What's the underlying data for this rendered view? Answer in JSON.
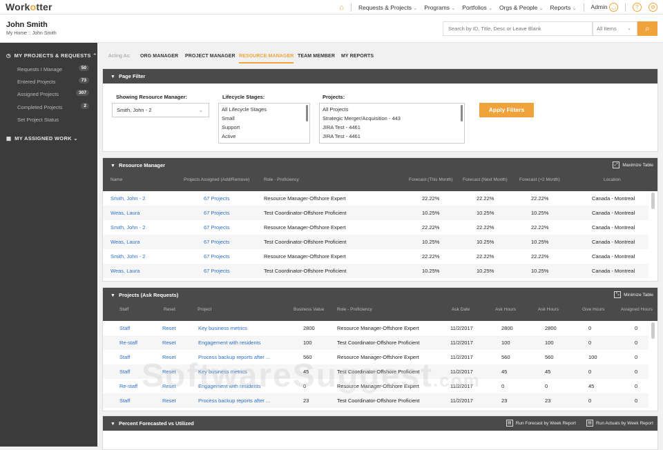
{
  "app": {
    "logo_prefix": "Work",
    "logo_o": "o",
    "logo_suffix": "tter"
  },
  "nav": {
    "items": [
      "Requests & Projects",
      "Programs",
      "Portfolios",
      "Orgs & People",
      "Reports"
    ],
    "user": "Admin",
    "help": "?"
  },
  "header": {
    "user_name": "John Smith",
    "breadcrumb": "My Home :: John Smith",
    "search_placeholder": "Search by ID, Title, Desc or Leave Blank",
    "scope": "All Items"
  },
  "sidebar": {
    "section1": "MY PROJECTS & REQUESTS",
    "items": [
      {
        "label": "Requests I Manage",
        "count": "50"
      },
      {
        "label": "Entered Projects",
        "count": "73"
      },
      {
        "label": "Assigned Projects",
        "count": "307"
      },
      {
        "label": "Completed Projects",
        "count": "2"
      },
      {
        "label": "Set Project Status",
        "count": ""
      }
    ],
    "section2": "MY ASSIGNED WORK"
  },
  "tabs": {
    "acting_as": "Acting As:",
    "items": [
      "ORG MANAGER",
      "PROJECT MANAGER",
      "RESOURCE MANAGER",
      "TEAM MEMBER",
      "MY REPORTS"
    ],
    "active": "RESOURCE MANAGER"
  },
  "filter": {
    "title": "Page Filter",
    "rm_label": "Showing Resource Manager:",
    "rm_value": "Smith, John - 2",
    "lc_label": "Lifecycle Stages:",
    "lc_options": [
      "All Lifecycle Stages",
      "Small",
      "Support",
      "Active"
    ],
    "proj_label": "Projects:",
    "proj_options": [
      "All Projects",
      "Strategic Merger/Acquisition - 443",
      "JIRA Test - 4461",
      "JIRA Test - 4461"
    ],
    "apply": "Apply Filters"
  },
  "rm_table": {
    "title": "Resource Manager",
    "action": "Maximize Table",
    "headers": [
      "Name",
      "Projects Assigned (Add/Remove)",
      "Role - Proficiency",
      "Forecast (This Month)",
      "Forecast (Next Month)",
      "Forecast (+2 Month)",
      "Location"
    ],
    "rows": [
      [
        "Smith, John - 2",
        "67 Projects",
        "Resource Manager-Offshore Expert",
        "22.22%",
        "22.22%",
        "22.22%",
        "Canada - Montreal"
      ],
      [
        "Weas, Laura",
        "67 Projects",
        "Test Coordinator-Offshore Proficient",
        "10.25%",
        "10.25%",
        "10.25%",
        "Canada - Montreal"
      ],
      [
        "Smith, John - 2",
        "67 Projects",
        "Resource Manager-Offshore Expert",
        "22.22%",
        "22.22%",
        "22.22%",
        "Canada - Montreal"
      ],
      [
        "Weas, Laura",
        "67 Projects",
        "Test Coordinator-Offshore Proficient",
        "10.25%",
        "10.25%",
        "10.25%",
        "Canada - Montreal"
      ],
      [
        "Smith, John - 2",
        "67 Projects",
        "Resource Manager-Offshore Expert",
        "22.22%",
        "22.22%",
        "22.22%",
        "Canada - Montreal"
      ],
      [
        "Weas, Laura",
        "67 Projects",
        "Test Coordinator-Offshore Proficient",
        "10.25%",
        "10.25%",
        "10.25%",
        "Canada - Montreal"
      ]
    ]
  },
  "proj_table": {
    "title": "Projects (Ask Requests)",
    "action": "Minimize Table",
    "headers": [
      "Staff",
      "Reset",
      "Project",
      "Business Value",
      "Role - Proficiency",
      "Ask Date",
      "Ask Hours",
      "Ask Hours",
      "Give Hours",
      "Assigned Hours"
    ],
    "rows": [
      [
        "Staff",
        "Reset",
        "Key business metrics",
        "2800",
        "Resource Manager-Offshore Expert",
        "11/2/2017",
        "2800",
        "2800",
        "0",
        "0"
      ],
      [
        "Re-staff",
        "Reset",
        "Engagement with residents",
        "100",
        "Test Coordinator-Offshore Proficient",
        "11/2/2017",
        "100",
        "100",
        "0",
        "0"
      ],
      [
        "Staff",
        "Reset",
        "Process backup reports after ...",
        "560",
        "Resource Manager-Offshore Expert",
        "11/2/2017",
        "560",
        "560",
        "100",
        "0"
      ],
      [
        "Staff",
        "Reset",
        "Key business metrics",
        "45",
        "Test Coordinator-Offshore Proficient",
        "11/2/2017",
        "45",
        "45",
        "0",
        "0"
      ],
      [
        "Re-staff",
        "Reset",
        "Engagement with residents",
        "0",
        "Resource Manager-Offshore Expert",
        "11/2/2017",
        "0",
        "0",
        "45",
        "0"
      ],
      [
        "Staff",
        "Reset",
        "Process backup reports after ...",
        "23",
        "Test Coordinator-Offshore Proficient",
        "11/2/2017",
        "23",
        "23",
        "0",
        "0"
      ]
    ]
  },
  "pct": {
    "title": "Percent Forecasted vs Utilized",
    "btn1": "Run Forecast by Week Report",
    "btn2": "Run Actuals by Week Report"
  },
  "watermark": {
    "main": "SoftwareSuggest",
    "suffix": ".com"
  }
}
